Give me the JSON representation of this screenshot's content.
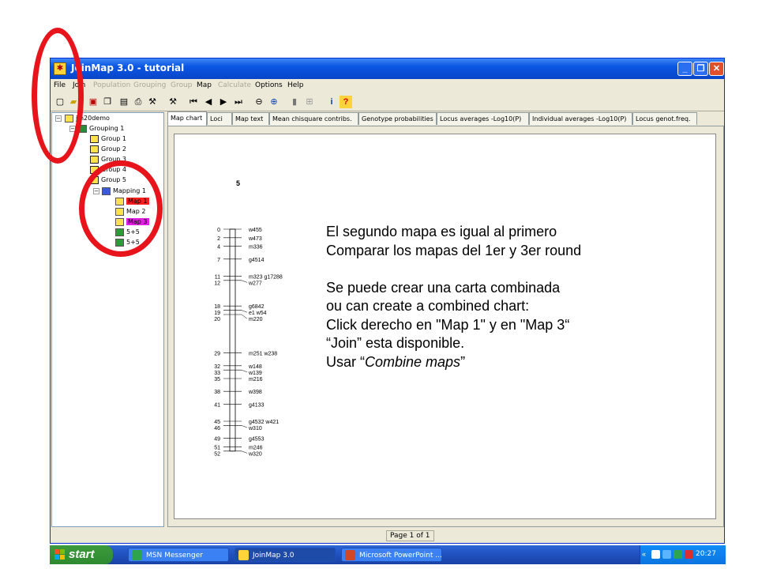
{
  "window": {
    "title": "JoinMap 3.0  - tutorial",
    "controls": {
      "minimize": "_",
      "restore": "❐",
      "close": "✕"
    }
  },
  "menu": [
    {
      "label": "File",
      "enabled": true
    },
    {
      "label": "Join",
      "enabled": true
    },
    {
      "label": "Population",
      "enabled": false
    },
    {
      "label": "Grouping",
      "enabled": false
    },
    {
      "label": "Group",
      "enabled": false
    },
    {
      "label": "Map",
      "enabled": true
    },
    {
      "label": "Calculate",
      "enabled": false
    },
    {
      "label": "Options",
      "enabled": true
    },
    {
      "label": "Help",
      "enabled": true
    }
  ],
  "toolbar_icons": [
    "new-icon",
    "open-icon",
    "load-icon",
    "copy-icon",
    "paste-icon",
    "clipboard-icon",
    "print-icon",
    "tools-icon",
    "hammer-icon",
    "first-icon",
    "prev-icon",
    "next-icon",
    "last-icon",
    "zoom-out-icon",
    "zoom-in-icon",
    "bar-icon",
    "grid-icon",
    "info-icon",
    "help-icon"
  ],
  "tree": [
    {
      "label": "jm20demo",
      "level": 0,
      "icon": "project-icon"
    },
    {
      "label": "Grouping 1",
      "level": 1,
      "icon": "grouping-icon"
    },
    {
      "label": "Group 1",
      "level": 2,
      "icon": "group-icon"
    },
    {
      "label": "Group 2",
      "level": 2,
      "icon": "group-icon"
    },
    {
      "label": "Group 3",
      "level": 2,
      "icon": "group-icon"
    },
    {
      "label": "Group 4",
      "level": 2,
      "icon": "group-icon"
    },
    {
      "label": "Group 5",
      "level": 2,
      "icon": "group-icon"
    },
    {
      "label": "Mapping 1",
      "level": 3,
      "icon": "mapping-icon"
    },
    {
      "label": "Map 1",
      "level": 4,
      "icon": "map-icon",
      "highlight": "#ff1f1f"
    },
    {
      "label": "Map 2",
      "level": 4,
      "icon": "map-icon"
    },
    {
      "label": "Map 3",
      "level": 4,
      "icon": "map-icon",
      "highlight": "#e020e0"
    },
    {
      "label": "5+5",
      "level": 4,
      "icon": "combined-icon"
    },
    {
      "label": "5+5",
      "level": 4,
      "icon": "combined-icon"
    }
  ],
  "tabs": [
    {
      "label": "Map chart",
      "active": true
    },
    {
      "label": "Loci",
      "active": false
    },
    {
      "label": "Map text",
      "active": false
    },
    {
      "label": "Mean chisquare contribs.",
      "active": false
    },
    {
      "label": "Genotype probabilities",
      "active": false
    },
    {
      "label": "Locus averages -Log10(P)",
      "active": false
    },
    {
      "label": "Individual averages -Log10(P)",
      "active": false
    },
    {
      "label": "Locus genot.freq.",
      "active": false
    }
  ],
  "map_chart": {
    "group_label": "5",
    "loci": [
      {
        "pos": 0,
        "name": "w455"
      },
      {
        "pos": 2,
        "name": "w473"
      },
      {
        "pos": 4,
        "name": "m336"
      },
      {
        "pos": 7,
        "name": "g4514"
      },
      {
        "pos": 11,
        "name": "m323 g17288"
      },
      {
        "pos": 12,
        "name": "w277"
      },
      {
        "pos": 18,
        "name": "g6842"
      },
      {
        "pos": 19,
        "name": "e1 w54"
      },
      {
        "pos": 20,
        "name": "m220"
      },
      {
        "pos": 29,
        "name": "m251 w238"
      },
      {
        "pos": 32,
        "name": "w148"
      },
      {
        "pos": 33,
        "name": "w139"
      },
      {
        "pos": 35,
        "name": "m216"
      },
      {
        "pos": 38,
        "name": "w398"
      },
      {
        "pos": 41,
        "name": "g4133"
      },
      {
        "pos": 45,
        "name": "g4532 w421"
      },
      {
        "pos": 46,
        "name": "w310"
      },
      {
        "pos": 49,
        "name": "g4553"
      },
      {
        "pos": 51,
        "name": "m246"
      },
      {
        "pos": 52,
        "name": "w320"
      }
    ]
  },
  "status": {
    "page": "Page 1 of 1"
  },
  "overlay_text": [
    "El segundo mapa es igual al primero",
    "Comparar los mapas del 1er y 3er round",
    "",
    "Se puede crear una carta combinada",
    "ou can create a combined chart:",
    "Click derecho en \"Map 1\"  y en \"Map 3“",
    "“Join” esta disponible."
  ],
  "overlay_last": {
    "prefix": "Usar “",
    "emphasis": "Combine maps",
    "suffix": "”"
  },
  "taskbar": {
    "start_label": "start",
    "tasks": [
      {
        "label": "MSN Messenger",
        "active": false
      },
      {
        "label": "JoinMap 3.0",
        "active": true
      },
      {
        "label": "Microsoft PowerPoint ...",
        "active": false
      }
    ],
    "clock": "20:27"
  },
  "colors": {
    "annotation_ring": "#e8141c",
    "title_blue": "#0a56e3",
    "start_green": "#3c9a3c"
  }
}
